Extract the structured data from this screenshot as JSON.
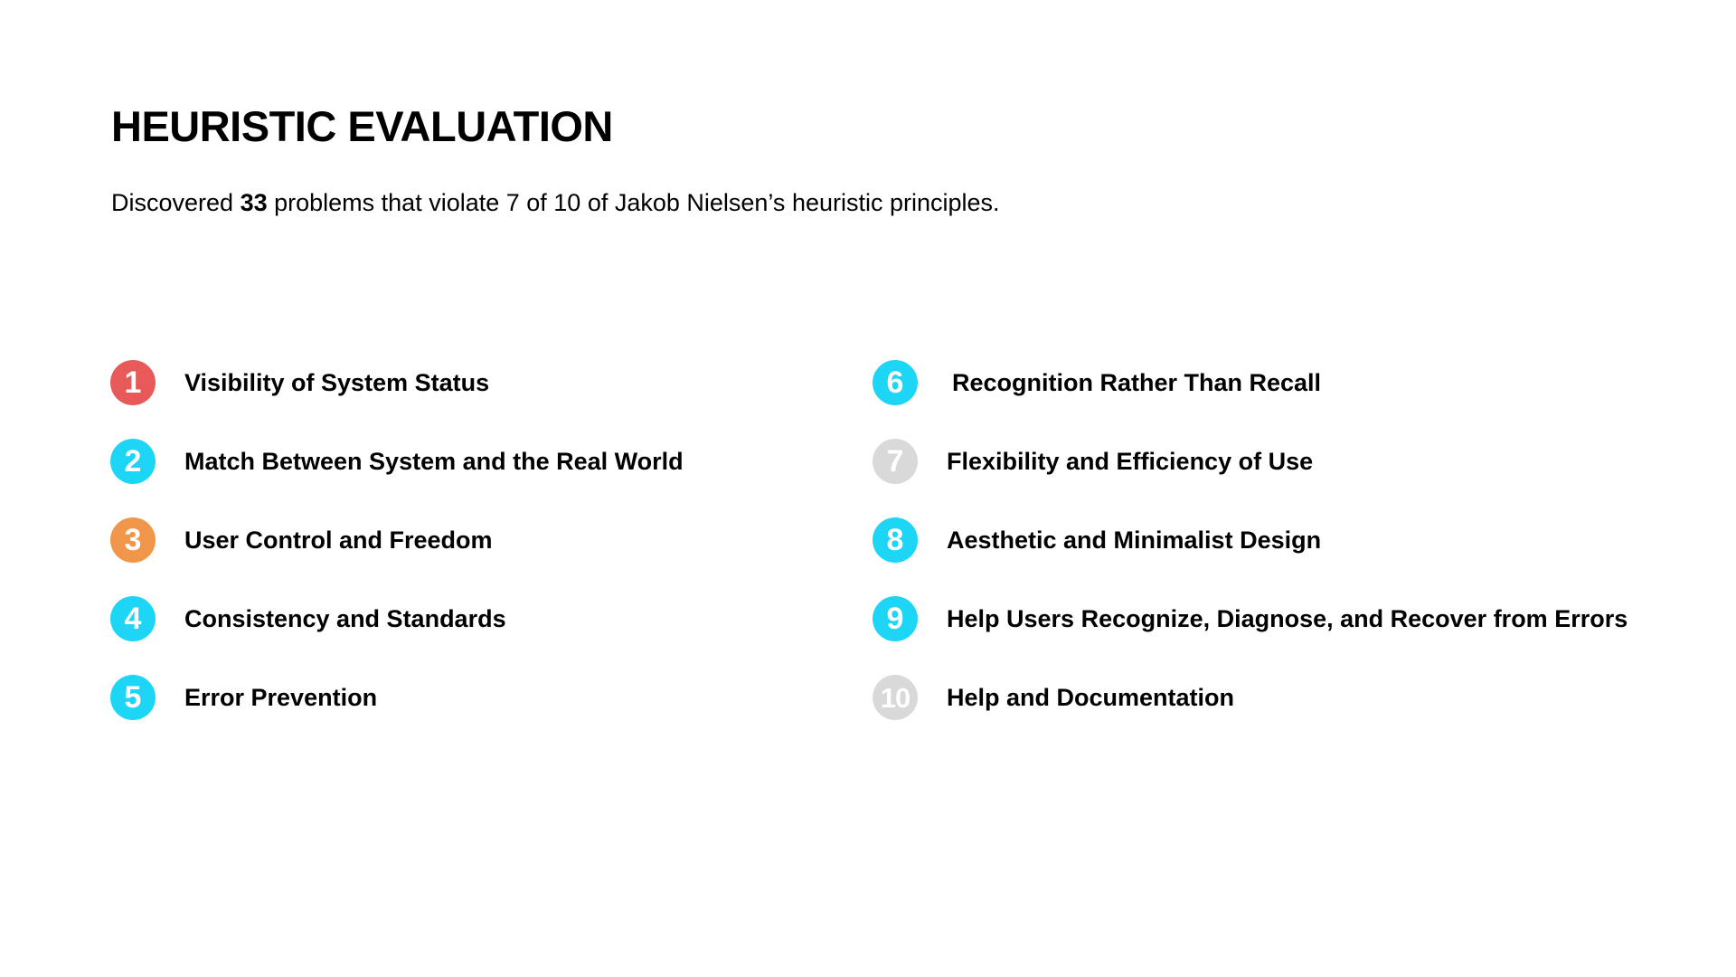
{
  "header": {
    "title": "HEURISTIC EVALUATION",
    "subtitle_prefix": "Discovered ",
    "subtitle_count": "33",
    "subtitle_suffix": " problems that violate 7 of 10 of Jakob Nielsen’s heuristic principles."
  },
  "colors": {
    "red": "#e85a5a",
    "cyan": "#1dd5f5",
    "orange": "#f0964a",
    "gray": "#d9d9d9"
  },
  "heuristics": [
    {
      "number": "1",
      "label": "Visibility of System Status",
      "color": "#e85a5a"
    },
    {
      "number": "2",
      "label": "Match Between System and the Real World",
      "color": "#1dd5f5"
    },
    {
      "number": "3",
      "label": "User Control and Freedom",
      "color": "#f0964a"
    },
    {
      "number": "4",
      "label": "Consistency and Standards",
      "color": "#1dd5f5"
    },
    {
      "number": "5",
      "label": "Error Prevention",
      "color": "#1dd5f5"
    },
    {
      "number": "6",
      "label": "Recognition Rather Than Recall",
      "color": "#1dd5f5"
    },
    {
      "number": "7",
      "label": "Flexibility and Efficiency of Use",
      "color": "#d9d9d9"
    },
    {
      "number": "8",
      "label": "Aesthetic and Minimalist Design",
      "color": "#1dd5f5"
    },
    {
      "number": "9",
      "label": "Help Users Recognize, Diagnose, and Recover from Errors",
      "color": "#1dd5f5"
    },
    {
      "number": "10",
      "label": "Help and Documentation",
      "color": "#d9d9d9"
    }
  ]
}
